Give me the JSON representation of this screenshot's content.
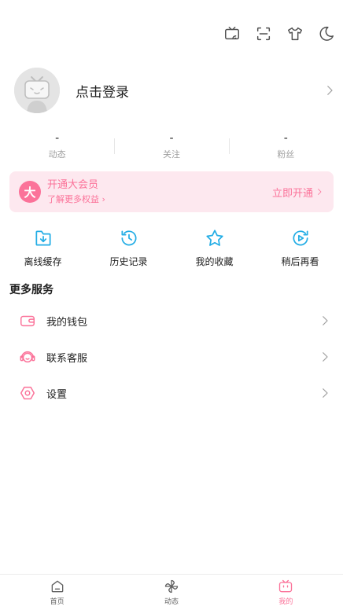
{
  "topbar": {
    "icons": [
      "tv-cast-icon",
      "scan-icon",
      "tshirt-icon",
      "moon-icon"
    ]
  },
  "profile": {
    "login_label": "点击登录"
  },
  "stats": [
    {
      "value": "-",
      "label": "动态"
    },
    {
      "value": "-",
      "label": "关注"
    },
    {
      "value": "-",
      "label": "粉丝"
    }
  ],
  "vip": {
    "badge": "大",
    "title": "开通大会员",
    "subtitle": "了解更多权益",
    "action": "立即开通"
  },
  "quick_actions": [
    {
      "label": "离线缓存",
      "icon": "download-icon"
    },
    {
      "label": "历史记录",
      "icon": "history-icon"
    },
    {
      "label": "我的收藏",
      "icon": "star-icon"
    },
    {
      "label": "稍后再看",
      "icon": "watch-later-icon"
    }
  ],
  "more_services": {
    "title": "更多服务",
    "items": [
      {
        "label": "我的钱包",
        "icon": "wallet-icon"
      },
      {
        "label": "联系客服",
        "icon": "headset-icon"
      },
      {
        "label": "设置",
        "icon": "settings-icon"
      }
    ]
  },
  "tabbar": {
    "items": [
      {
        "label": "首页",
        "icon": "home-icon"
      },
      {
        "label": "动态",
        "icon": "pinwheel-icon"
      },
      {
        "label": "我的",
        "icon": "tv-icon",
        "active": true
      }
    ]
  },
  "colors": {
    "accent": "#fb7299",
    "vip_bg": "#fde8ef",
    "quick_icon": "#23ade5"
  }
}
